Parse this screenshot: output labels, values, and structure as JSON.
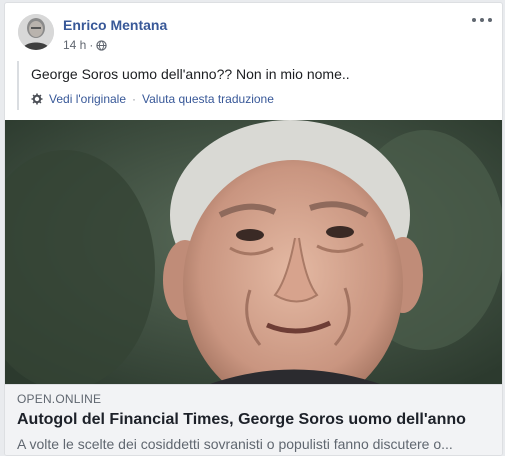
{
  "post": {
    "author": "Enrico Mentana",
    "time": "14 h",
    "privacy_icon": "globe-icon",
    "text": "George Soros uomo dell'anno?? Non in mio nome..",
    "translation": {
      "see_original": "Vedi l'originale",
      "separator": "·",
      "rate_translation": "Valuta questa traduzione"
    }
  },
  "link_preview": {
    "domain": "OPEN.ONLINE",
    "title": "Autogol del Financial Times, George Soros uomo dell'anno",
    "description": "A volte le scelte dei cosiddetti sovranisti o populisti fanno discutere o..."
  },
  "colors": {
    "author_link": "#385898",
    "meta_text": "#616770",
    "link_box_bg": "#f2f3f5"
  }
}
